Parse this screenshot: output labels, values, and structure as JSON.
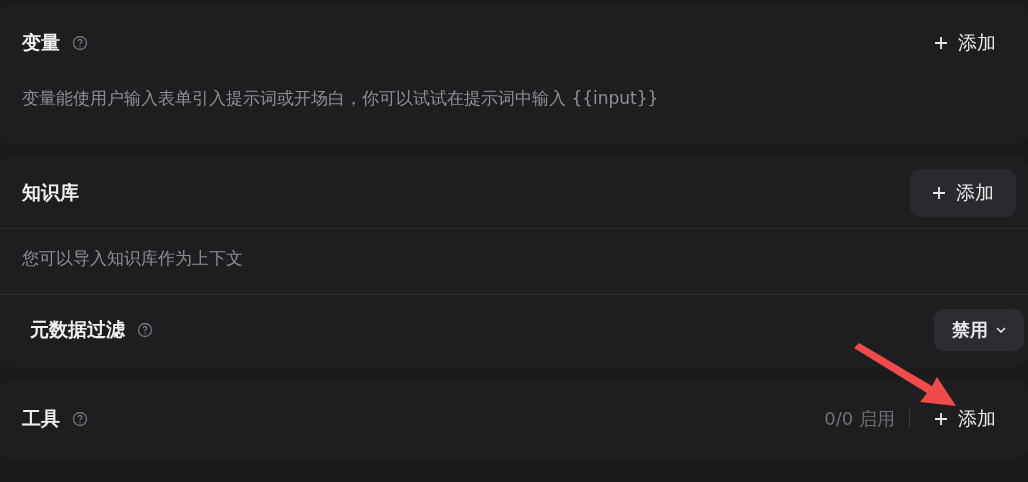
{
  "sections": [
    {
      "title": "变量",
      "help": true,
      "action": {
        "label": "添加",
        "kind": "plain"
      },
      "description": "变量能使用户输入表单引入提示词或开场白，你可以试试在提示词中输入 {{input}}"
    },
    {
      "title": "知识库",
      "help": false,
      "action": {
        "label": "添加",
        "kind": "filled"
      },
      "description": "您可以导入知识库作为上下文",
      "filter": {
        "label": "元数据过滤",
        "help": true,
        "value": "禁用"
      }
    },
    {
      "title": "工具",
      "help": true,
      "status": "0/0 启用",
      "action": {
        "label": "添加",
        "kind": "plain"
      }
    }
  ]
}
